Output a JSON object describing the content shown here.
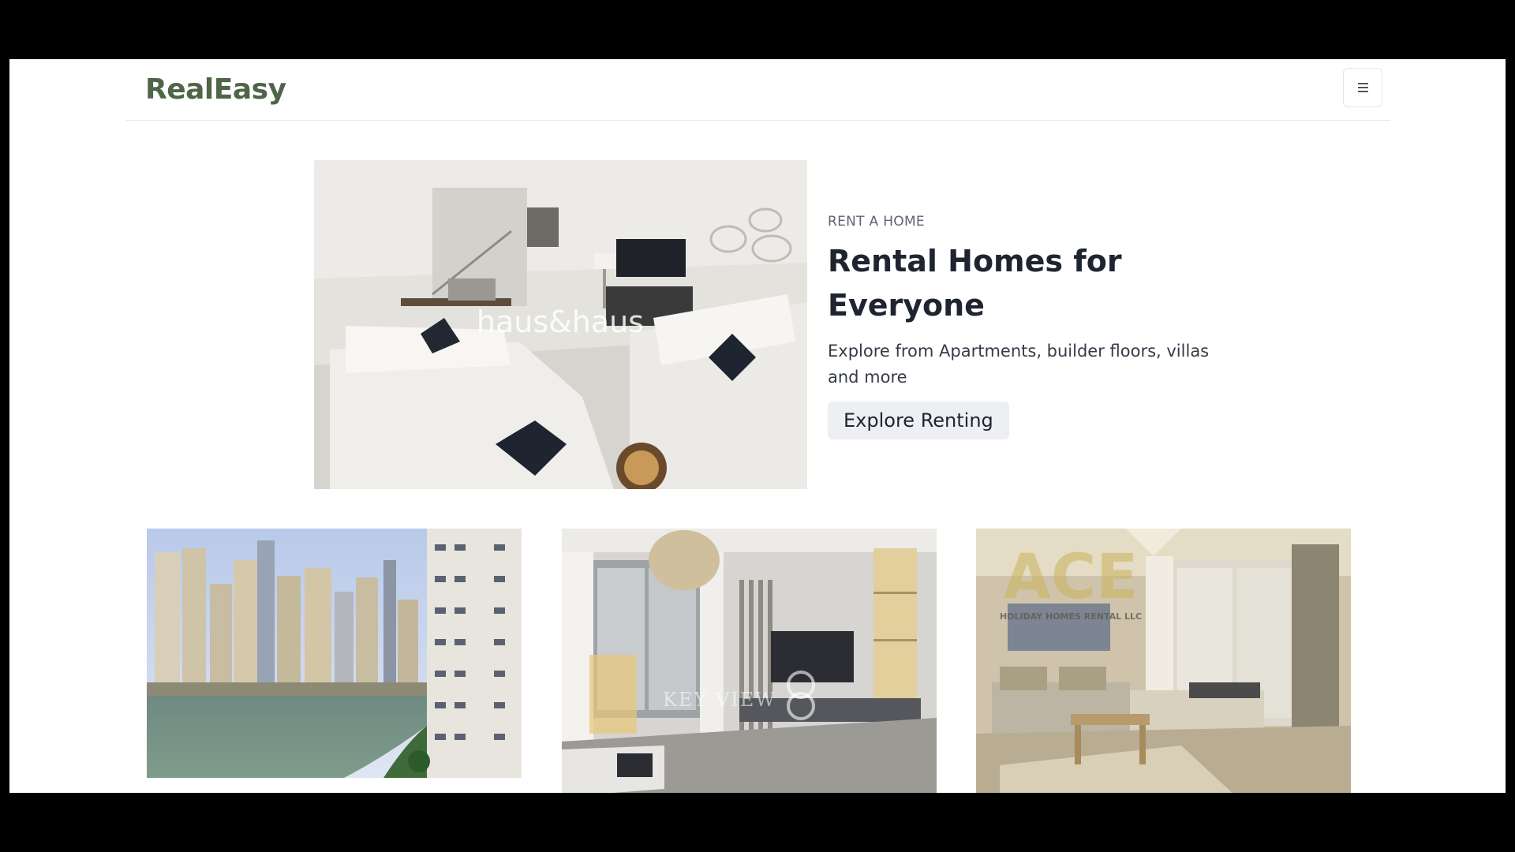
{
  "app": {
    "brand": "RealEasy",
    "menu_icon": "hamburger-icon"
  },
  "hero": {
    "eyebrow": "RENT A HOME",
    "title": "Rental Homes for Everyone",
    "description": "Explore from Apartments, builder floors, villas and more",
    "cta_label": "Explore Renting",
    "image_watermark": "haus&haus"
  },
  "cards": [
    {
      "image": "marina-skyline-photo"
    },
    {
      "image": "living-room-photo",
      "watermark": "KEY VIEW"
    },
    {
      "image": "bedroom-studio-photo",
      "watermark": "ACE",
      "watermark_sub": "HOLIDAY HOMES RENTAL LLC"
    }
  ],
  "colors": {
    "brand": "#4f6549",
    "text_dark": "#1f2530",
    "eyebrow": "#5d6475",
    "button_bg": "#eeeff3"
  }
}
